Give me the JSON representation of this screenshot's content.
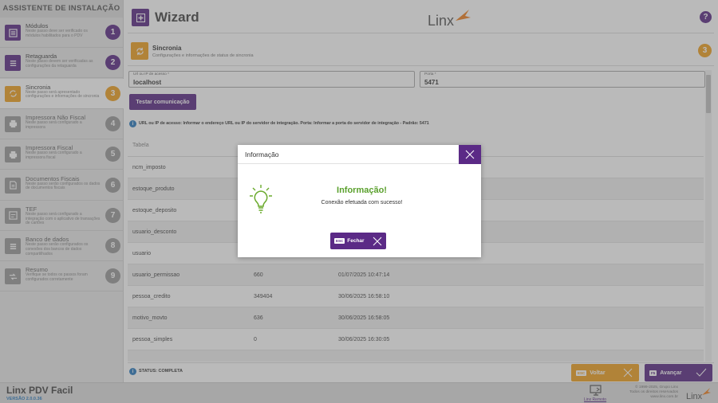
{
  "sidebar": {
    "title": "ASSISTENTE DE INSTALAÇÃO",
    "steps": [
      {
        "title": "Módulos",
        "desc": "Neste passo deve ser verificado os módulos habilitados para o PDV",
        "num": "1",
        "state": "done"
      },
      {
        "title": "Retaguarda",
        "desc": "Neste passo devem ser verificadas as configurações da retaguarda",
        "num": "2",
        "state": "done"
      },
      {
        "title": "Sincronia",
        "desc": "Neste passo será apresentado configurações e informações de sincronia",
        "num": "3",
        "state": "active"
      },
      {
        "title": "Impressora Não Fiscal",
        "desc": "Neste passo será configurado a impressora",
        "num": "4",
        "state": "pending"
      },
      {
        "title": "Impressora Fiscal",
        "desc": "Neste passo será configurado a impressora fiscal",
        "num": "5",
        "state": "pending"
      },
      {
        "title": "Documentos Fiscais",
        "desc": "Neste passo serão configurados os dados de documentos fiscais",
        "num": "6",
        "state": "pending"
      },
      {
        "title": "TEF",
        "desc": "Neste passo será configurado a integração com o aplicativo de transações de cartões",
        "num": "7",
        "state": "pending"
      },
      {
        "title": "Banco de dados",
        "desc": "Neste passo serão configurados os conexões dos bancos de dados compartilhados",
        "num": "8",
        "state": "pending"
      },
      {
        "title": "Resumo",
        "desc": "Verifique se todos os passos foram configurados corretamente",
        "num": "9",
        "state": "pending"
      }
    ]
  },
  "header": {
    "title": "Wizard",
    "logo_text": "Linx",
    "help": "?"
  },
  "section": {
    "title": "Sincronia",
    "subtitle": "Configurações e informações de status de sincronia",
    "num": "3"
  },
  "form": {
    "url_label": "Url ou IP de acesso *",
    "url_value": "localhost",
    "port_label": "Porta *",
    "port_value": "5471",
    "test_button": "Testar comunicação",
    "info_icon": "i",
    "info_text": "URL ou IP de acesso: Informar o endereço URL ou IP do servidor de integração. Porta: Informar a porta do servidor de integração - Padrão: 5471"
  },
  "table": {
    "headers": [
      "Tabela",
      "",
      "",
      ""
    ],
    "rows": [
      [
        "ncm_imposto",
        "",
        ""
      ],
      [
        "estoque_produto",
        "",
        ""
      ],
      [
        "estoque_deposito",
        "",
        ""
      ],
      [
        "usuario_desconto",
        "",
        ""
      ],
      [
        "usuario",
        "",
        ""
      ],
      [
        "usuario_permissao",
        "660",
        "01/07/2025 10:47:14"
      ],
      [
        "pessoa_credito",
        "349404",
        "30/06/2025 16:58:10"
      ],
      [
        "motivo_movto",
        "636",
        "30/06/2025 16:58:05"
      ],
      [
        "pessoa_simples",
        "0",
        "30/06/2025 16:30:05"
      ],
      [
        "",
        "",
        ""
      ]
    ]
  },
  "status": {
    "icon": "i",
    "text": "STATUS: COMPLETA"
  },
  "nav": {
    "back_key": "ESC",
    "back_label": "Voltar",
    "next_key": "F5",
    "next_label": "Avançar"
  },
  "footer": {
    "app_name": "Linx PDV Facil",
    "version": "VERSÃO 2.0.0.36",
    "remote_label": "Linx Remoto",
    "copyright_1": "© 1999-2025, Grupo Linx",
    "copyright_2": "Todos os direitos reservados",
    "copyright_3": "www.linx.com.br",
    "logo_text": "Linx"
  },
  "modal": {
    "title": "Informação",
    "heading": "Informação!",
    "message": "Conexão efetuada com sucesso!",
    "close_key": "ESC",
    "close_label": "Fechar"
  },
  "colors": {
    "purple": "#5b2a86",
    "orange": "#f0a020",
    "green": "#5aa02c",
    "blue": "#2a7ac0"
  }
}
